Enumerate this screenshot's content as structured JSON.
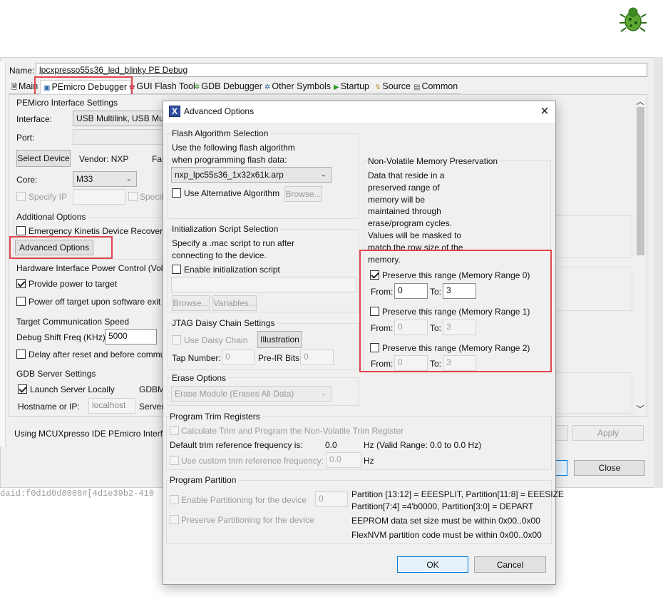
{
  "launch": {
    "name_label": "Name:",
    "name_value": "lpcxpresso55s36_led_blinky PE Debug",
    "tabs": [
      {
        "label": "Main",
        "icon": "document-icon"
      },
      {
        "label": "PEmicro Debugger",
        "icon": "debugger-icon"
      },
      {
        "label": "GUI Flash Tool",
        "icon": "flash-gear-icon"
      },
      {
        "label": "GDB Debugger",
        "icon": "gear-icon"
      },
      {
        "label": "Other Symbols",
        "icon": "gear-icon"
      },
      {
        "label": "Startup",
        "icon": "play-icon"
      },
      {
        "label": "Source",
        "icon": "source-icon"
      },
      {
        "label": "Common",
        "icon": "common-icon"
      }
    ],
    "interface_settings": {
      "title": "PEMicro Interface Settings",
      "interface_label": "Interface:",
      "interface_value": "USB Multilink, USB Mult",
      "port_label": "Port:",
      "select_device": "Select Device",
      "vendor": "Vendor: NXP",
      "family_partial": "Fan",
      "core_label": "Core:",
      "core_value": "M33",
      "specify_ip": "Specify IP",
      "specify_partial": "Specif"
    },
    "additional_options": {
      "title": "Additional Options",
      "emergency": "Emergency Kinetis Device Recovery",
      "advanced_button": "Advanced Options"
    },
    "power": {
      "title": "Hardware Interface Power Control (Volt",
      "provide": "Provide power to target",
      "power_off": "Power off target upon software exit"
    },
    "speed": {
      "title": "Target Communication Speed",
      "freq_label": "Debug Shift Freq (KHz)",
      "freq_value": "5000",
      "delay": "Delay after reset and before commu"
    },
    "gdb": {
      "title": "GDB Server Settings",
      "launch_locally": "Launch Server Locally",
      "gdbm_partial": "GDBM",
      "host_label": "Hostname or IP:",
      "host_value": "localhost",
      "server_partial": "Server"
    },
    "footer_text": "Using MCUXpresso IDE PEmicro Interfac",
    "apply": "Apply",
    "close": "Close",
    "background_text": "daid:f0d1d0d8008#[4d1e39b2-410"
  },
  "dialog": {
    "title": "Advanced Options",
    "flash": {
      "title": "Flash Algorithm Selection",
      "desc1": "Use the following flash algorithm",
      "desc2": "when programming flash data:",
      "algorithm": "nxp_lpc55s36_1x32x61k.arp",
      "use_alt": "Use Alternative Algorithm",
      "browse": "Browse..."
    },
    "init": {
      "title": "Initialization Script Selection",
      "desc1": "Specify a .mac script to run after",
      "desc2": "connecting to the device.",
      "enable": "Enable initialization script",
      "browse": "Browse...",
      "variables": "Variables..."
    },
    "jtag": {
      "title": "JTAG Daisy Chain Settings",
      "use": "Use Daisy Chain",
      "illustration": "Illustration",
      "tap_label": "Tap Number:",
      "tap_value": "0",
      "preir_label": "Pre-IR Bits:",
      "preir_value": "0"
    },
    "erase": {
      "title": "Erase Options",
      "value": "Erase Module (Erases All Data)"
    },
    "nvm": {
      "title": "Non-Volatile Memory Preservation",
      "desc": [
        "Data that reside in a",
        "preserved range of",
        "memory will be",
        "maintained through",
        "erase/program cycles.",
        "Values will be masked to",
        "match the row size of the",
        "memory."
      ],
      "ranges": [
        {
          "label": "Preserve this range (Memory Range 0)",
          "checked": true,
          "from": "0",
          "to": "3"
        },
        {
          "label": "Preserve this range (Memory Range 1)",
          "checked": false,
          "from": "0",
          "to": "3"
        },
        {
          "label": "Preserve this range (Memory Range 2)",
          "checked": false,
          "from": "0",
          "to": "3"
        }
      ],
      "from_label": "From:",
      "to_label": "To:"
    },
    "trim": {
      "title": "Program Trim Registers",
      "calc": "Calculate Trim and Program the Non-Volatile Trim Register",
      "default_label": "Default trim reference frequency is:",
      "default_value": "0.0",
      "range_text": "Hz (Valid Range: 0.0 to 0.0 Hz)",
      "custom_label": "Use custom trim reference frequency:",
      "custom_value": "0.0",
      "hz": "Hz"
    },
    "partition": {
      "title": "Program Partition",
      "enable": "Enable Partitioning for the device",
      "enable_value": "0",
      "preserve": "Preserve Partitioning for the device",
      "line1": "Partition [13:12] = EEESPLIT, Partition[11:8] = EEESIZE",
      "line2": "Partition[7:4] =4'b0000, Partition[3:0] = DEPART",
      "line3": "EEPROM data set size must be within 0x00..0x00",
      "line4": "FlexNVM partition code must be within 0x00..0x00"
    },
    "ok": "OK",
    "cancel": "Cancel"
  },
  "colors": {
    "highlight": "#e0454c",
    "accent": "#0078d7"
  }
}
